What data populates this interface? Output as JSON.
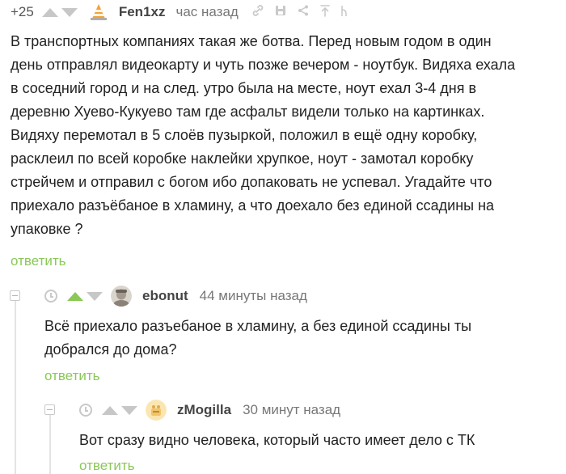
{
  "comments": [
    {
      "rating": "+25",
      "author": "Fen1xz",
      "time": "час назад",
      "lines": [
        "В транспортных компаниях такая же ботва. Перед новым годом в один",
        "день отправлял видеокарту и чуть позже вечером - ноутбук. Видяха ехала",
        "в соседний город и на след. утро была на месте, ноут ехал 3-4 дня в",
        "деревню Хуево-Кукуево там где асфальт видели только на картинках.",
        "Видяху перемотал в 5 слоёв пузыркой, положил в ещё одну коробку,",
        "расклеил по всей коробке наклейки хрупкое, ноут - замотал коробку",
        "стрейчем и отправил с богом ибо допаковать не успевал. Угадайте что",
        "приехало разъёбаное в хламину, а что доехало без единой ссадины на",
        "упаковке ?"
      ],
      "reply_label": "ответить",
      "icons": [
        "avatar-cone",
        "link-icon",
        "save-icon",
        "share-icon",
        "parent-icon",
        "branch-icon"
      ]
    },
    {
      "author": "ebonut",
      "time": "44 минуты назад",
      "lines": [
        "Всё приехало разъебаное в хламину, а без единой ссадины ты",
        "добрался до дома?"
      ],
      "reply_label": "ответить",
      "vote_state": "up"
    },
    {
      "author": "zMogilla",
      "time": "30 минут назад",
      "lines": [
        "Вот сразу видно человека, который часто имеет дело с ТК"
      ],
      "reply_label": "ответить"
    }
  ],
  "colors": {
    "accent_green": "#8ac858",
    "grey_icon": "#c7c7c7",
    "text": "#222222"
  }
}
